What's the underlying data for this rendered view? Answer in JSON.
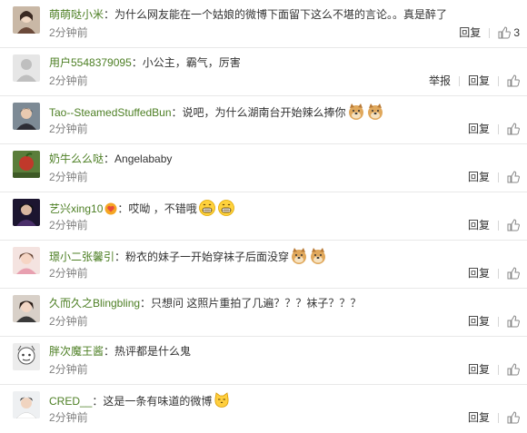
{
  "actions": {
    "report_label": "举报",
    "reply_label": "回复"
  },
  "comments": [
    {
      "user": "萌萌哒小米",
      "text": "：为什么网友能在一个姑娘的微博下面留下这么不堪的言论。。真是醉了",
      "time": "2分钟前",
      "likes": "3",
      "has_report": false
    },
    {
      "user": "用户5548379095",
      "text": "：小公主，霸气，厉害",
      "time": "2分钟前",
      "likes": "",
      "has_report": true
    },
    {
      "user": "Tao--SteamedStuffedBun",
      "text": "：说吧，为什么湖南台开始辣么捧你",
      "time": "2分钟前",
      "likes": "",
      "has_report": false,
      "emojis": [
        "doge-emoji",
        "doge-emoji"
      ]
    },
    {
      "user": "奶牛么么哒",
      "text": "：Angelababy",
      "time": "2分钟前",
      "likes": "",
      "has_report": false
    },
    {
      "user": "艺兴xing10",
      "text": "：哎呦 ，不错哦",
      "time": "2分钟前",
      "likes": "",
      "has_report": false,
      "badge": "heart-badge-icon",
      "emojis": [
        "grin-emoji",
        "grin-emoji"
      ]
    },
    {
      "user": "璟小二张馨引",
      "text": "：粉衣的妹子一开始穿袜子后面没穿",
      "time": "2分钟前",
      "likes": "",
      "has_report": false,
      "emojis": [
        "doge-emoji",
        "doge-emoji"
      ]
    },
    {
      "user": "久而久之Blingbling",
      "text": "：只想问 这照片重拍了几遍？？？袜子？？？",
      "time": "2分钟前",
      "likes": "",
      "has_report": false
    },
    {
      "user": "胖次魔王酱",
      "text": "：热评都是什么鬼",
      "time": "2分钟前",
      "likes": "",
      "has_report": false
    },
    {
      "user": "CRED__",
      "text": "：这是一条有味道的微博",
      "time": "2分钟前",
      "likes": "",
      "has_report": false,
      "emojis": [
        "cat-emoji"
      ]
    }
  ],
  "colors": {
    "username": "#4d7f24",
    "time": "#808080",
    "text": "#333333",
    "divider": "#e8e8e8"
  }
}
